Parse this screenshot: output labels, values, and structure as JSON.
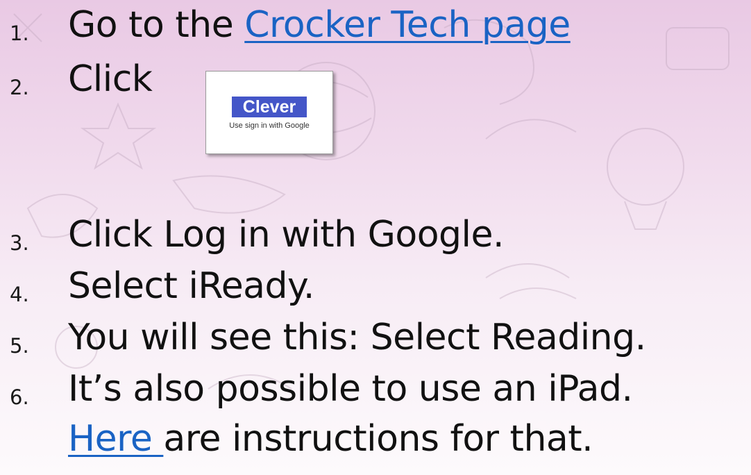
{
  "steps": [
    {
      "number": "1.",
      "prefix": "Go to the ",
      "link_text": "Crocker Tech page"
    },
    {
      "number": "2.",
      "text": "Click"
    },
    {
      "number": "3.",
      "text": "Click Log in with Google."
    },
    {
      "number": "4.",
      "text": "Select iReady."
    },
    {
      "number": "5.",
      "text": "You will see this: Select Reading."
    },
    {
      "number": "6.",
      "text": "It’s also possible to use an iPad."
    }
  ],
  "step6_line2": {
    "link_text": "Here ",
    "suffix": "are instructions for that."
  },
  "clever_button": {
    "logo_text": "Clever",
    "subtitle": "Use sign in with Google"
  },
  "colors": {
    "link": "#1a63c4",
    "clever_brand": "#4456c8"
  }
}
